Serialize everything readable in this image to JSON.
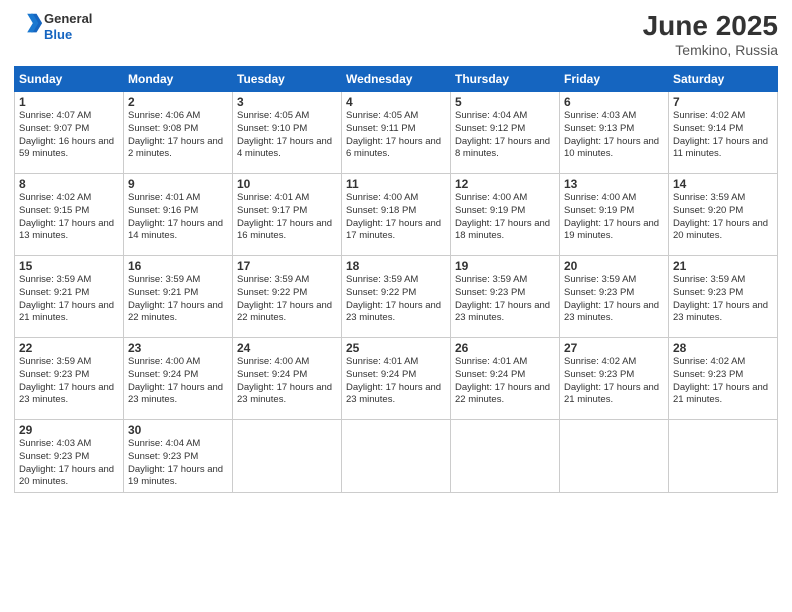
{
  "header": {
    "logo_general": "General",
    "logo_blue": "Blue",
    "month_year": "June 2025",
    "location": "Temkino, Russia"
  },
  "weekdays": [
    "Sunday",
    "Monday",
    "Tuesday",
    "Wednesday",
    "Thursday",
    "Friday",
    "Saturday"
  ],
  "weeks": [
    [
      {
        "day": 1,
        "sunrise": "Sunrise: 4:07 AM",
        "sunset": "Sunset: 9:07 PM",
        "daylight": "Daylight: 16 hours and 59 minutes."
      },
      {
        "day": 2,
        "sunrise": "Sunrise: 4:06 AM",
        "sunset": "Sunset: 9:08 PM",
        "daylight": "Daylight: 17 hours and 2 minutes."
      },
      {
        "day": 3,
        "sunrise": "Sunrise: 4:05 AM",
        "sunset": "Sunset: 9:10 PM",
        "daylight": "Daylight: 17 hours and 4 minutes."
      },
      {
        "day": 4,
        "sunrise": "Sunrise: 4:05 AM",
        "sunset": "Sunset: 9:11 PM",
        "daylight": "Daylight: 17 hours and 6 minutes."
      },
      {
        "day": 5,
        "sunrise": "Sunrise: 4:04 AM",
        "sunset": "Sunset: 9:12 PM",
        "daylight": "Daylight: 17 hours and 8 minutes."
      },
      {
        "day": 6,
        "sunrise": "Sunrise: 4:03 AM",
        "sunset": "Sunset: 9:13 PM",
        "daylight": "Daylight: 17 hours and 10 minutes."
      },
      {
        "day": 7,
        "sunrise": "Sunrise: 4:02 AM",
        "sunset": "Sunset: 9:14 PM",
        "daylight": "Daylight: 17 hours and 11 minutes."
      }
    ],
    [
      {
        "day": 8,
        "sunrise": "Sunrise: 4:02 AM",
        "sunset": "Sunset: 9:15 PM",
        "daylight": "Daylight: 17 hours and 13 minutes."
      },
      {
        "day": 9,
        "sunrise": "Sunrise: 4:01 AM",
        "sunset": "Sunset: 9:16 PM",
        "daylight": "Daylight: 17 hours and 14 minutes."
      },
      {
        "day": 10,
        "sunrise": "Sunrise: 4:01 AM",
        "sunset": "Sunset: 9:17 PM",
        "daylight": "Daylight: 17 hours and 16 minutes."
      },
      {
        "day": 11,
        "sunrise": "Sunrise: 4:00 AM",
        "sunset": "Sunset: 9:18 PM",
        "daylight": "Daylight: 17 hours and 17 minutes."
      },
      {
        "day": 12,
        "sunrise": "Sunrise: 4:00 AM",
        "sunset": "Sunset: 9:19 PM",
        "daylight": "Daylight: 17 hours and 18 minutes."
      },
      {
        "day": 13,
        "sunrise": "Sunrise: 4:00 AM",
        "sunset": "Sunset: 9:19 PM",
        "daylight": "Daylight: 17 hours and 19 minutes."
      },
      {
        "day": 14,
        "sunrise": "Sunrise: 3:59 AM",
        "sunset": "Sunset: 9:20 PM",
        "daylight": "Daylight: 17 hours and 20 minutes."
      }
    ],
    [
      {
        "day": 15,
        "sunrise": "Sunrise: 3:59 AM",
        "sunset": "Sunset: 9:21 PM",
        "daylight": "Daylight: 17 hours and 21 minutes."
      },
      {
        "day": 16,
        "sunrise": "Sunrise: 3:59 AM",
        "sunset": "Sunset: 9:21 PM",
        "daylight": "Daylight: 17 hours and 22 minutes."
      },
      {
        "day": 17,
        "sunrise": "Sunrise: 3:59 AM",
        "sunset": "Sunset: 9:22 PM",
        "daylight": "Daylight: 17 hours and 22 minutes."
      },
      {
        "day": 18,
        "sunrise": "Sunrise: 3:59 AM",
        "sunset": "Sunset: 9:22 PM",
        "daylight": "Daylight: 17 hours and 23 minutes."
      },
      {
        "day": 19,
        "sunrise": "Sunrise: 3:59 AM",
        "sunset": "Sunset: 9:23 PM",
        "daylight": "Daylight: 17 hours and 23 minutes."
      },
      {
        "day": 20,
        "sunrise": "Sunrise: 3:59 AM",
        "sunset": "Sunset: 9:23 PM",
        "daylight": "Daylight: 17 hours and 23 minutes."
      },
      {
        "day": 21,
        "sunrise": "Sunrise: 3:59 AM",
        "sunset": "Sunset: 9:23 PM",
        "daylight": "Daylight: 17 hours and 23 minutes."
      }
    ],
    [
      {
        "day": 22,
        "sunrise": "Sunrise: 3:59 AM",
        "sunset": "Sunset: 9:23 PM",
        "daylight": "Daylight: 17 hours and 23 minutes."
      },
      {
        "day": 23,
        "sunrise": "Sunrise: 4:00 AM",
        "sunset": "Sunset: 9:24 PM",
        "daylight": "Daylight: 17 hours and 23 minutes."
      },
      {
        "day": 24,
        "sunrise": "Sunrise: 4:00 AM",
        "sunset": "Sunset: 9:24 PM",
        "daylight": "Daylight: 17 hours and 23 minutes."
      },
      {
        "day": 25,
        "sunrise": "Sunrise: 4:01 AM",
        "sunset": "Sunset: 9:24 PM",
        "daylight": "Daylight: 17 hours and 23 minutes."
      },
      {
        "day": 26,
        "sunrise": "Sunrise: 4:01 AM",
        "sunset": "Sunset: 9:24 PM",
        "daylight": "Daylight: 17 hours and 22 minutes."
      },
      {
        "day": 27,
        "sunrise": "Sunrise: 4:02 AM",
        "sunset": "Sunset: 9:23 PM",
        "daylight": "Daylight: 17 hours and 21 minutes."
      },
      {
        "day": 28,
        "sunrise": "Sunrise: 4:02 AM",
        "sunset": "Sunset: 9:23 PM",
        "daylight": "Daylight: 17 hours and 21 minutes."
      }
    ],
    [
      {
        "day": 29,
        "sunrise": "Sunrise: 4:03 AM",
        "sunset": "Sunset: 9:23 PM",
        "daylight": "Daylight: 17 hours and 20 minutes."
      },
      {
        "day": 30,
        "sunrise": "Sunrise: 4:04 AM",
        "sunset": "Sunset: 9:23 PM",
        "daylight": "Daylight: 17 hours and 19 minutes."
      },
      null,
      null,
      null,
      null,
      null
    ]
  ]
}
